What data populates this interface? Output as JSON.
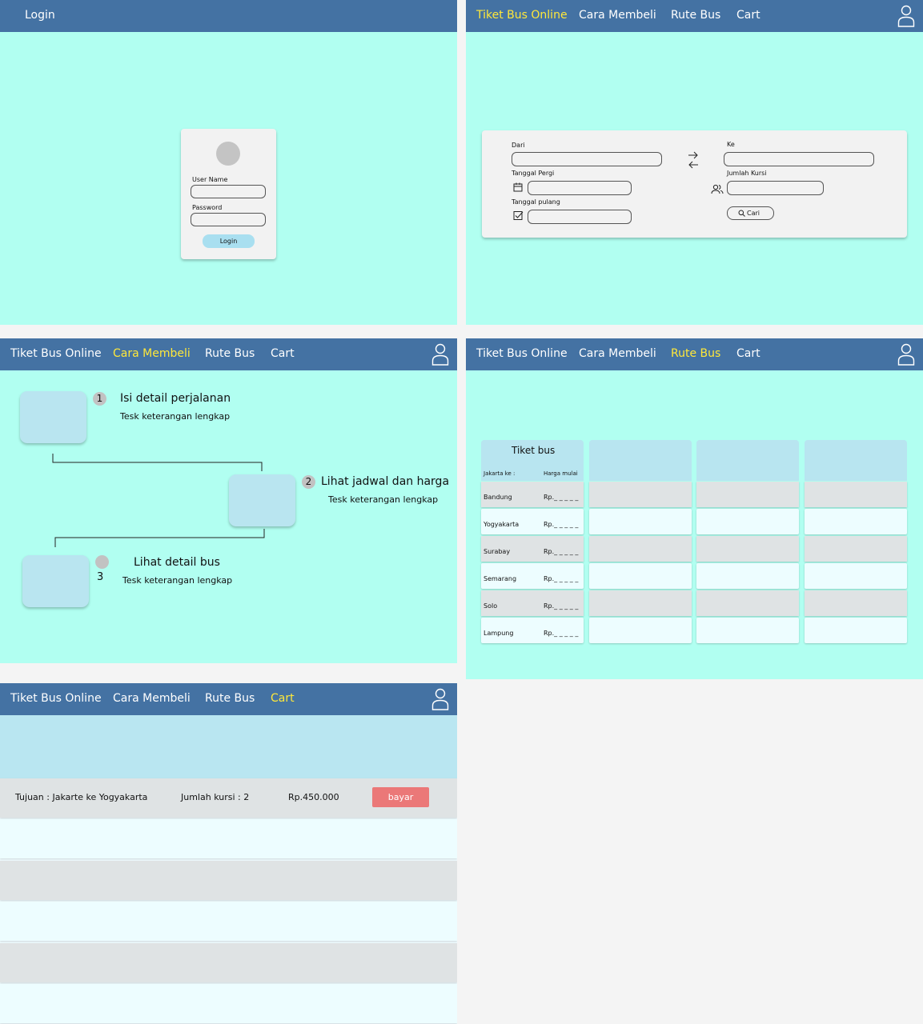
{
  "login_screen": {
    "title": "Login",
    "username_label": "User Name",
    "password_label": "Password",
    "login_button": "Login"
  },
  "nav": {
    "brand": "Tiket Bus Online",
    "items": [
      "Cara Membeli",
      "Rute Bus",
      "Cart"
    ],
    "active_color": "#ffe83a",
    "bar_color": "#4472a3"
  },
  "search_screen": {
    "from_label": "Dari",
    "to_label": "Ke",
    "depart_date_label": "Tanggal Pergi",
    "seats_label": "Jumlah Kursi",
    "return_date_label": "Tanggal pulang",
    "search_button": "Cari"
  },
  "howto_screen": {
    "steps": [
      {
        "number": "1",
        "title": "Isi detail perjalanan",
        "desc": "Tesk keterangan lengkap"
      },
      {
        "number": "2",
        "title": "Lihat jadwal dan harga",
        "desc": "Tesk keterangan lengkap"
      },
      {
        "number": "3",
        "title": "Lihat detail bus",
        "desc": "Tesk keterangan lengkap"
      }
    ]
  },
  "route_screen": {
    "table_title": "Tiket bus",
    "col_from": "Jakarta ke :",
    "col_price": "Harga mulai",
    "routes": [
      {
        "name": "Bandung",
        "price": "Rp._ _ _ _ _"
      },
      {
        "name": "Yogyakarta",
        "price": "Rp._ _ _ _ _"
      },
      {
        "name": "Surabay",
        "price": "Rp._ _ _ _ _"
      },
      {
        "name": "Semarang",
        "price": "Rp._ _ _ _ _"
      },
      {
        "name": "Solo",
        "price": "Rp._ _ _ _ _"
      },
      {
        "name": "Lampung",
        "price": "Rp._ _ _ _ _"
      }
    ]
  },
  "cart_screen": {
    "destination": "Tujuan : Jakarte ke Yogyakarta",
    "seats": "Jumlah kursi : 2",
    "price": "Rp.450.000",
    "pay_button": "bayar",
    "pay_color": "#eb7878"
  }
}
